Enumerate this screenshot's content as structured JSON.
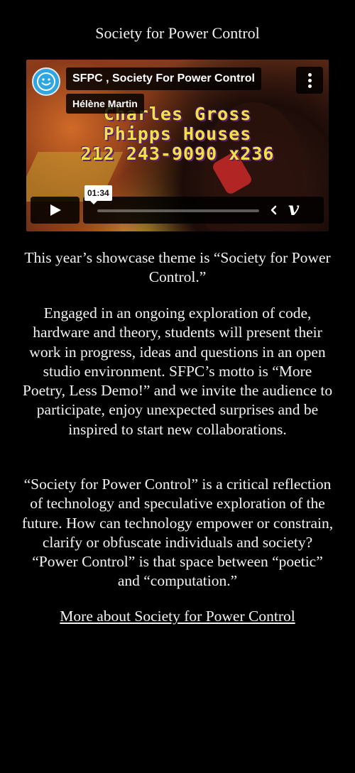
{
  "header": {
    "title": "Society for Power Control"
  },
  "video": {
    "title": "SFPC , Society For Power Control",
    "author": "Hélène Martin",
    "frame_text": [
      "Charles Gross",
      "Phipps Houses",
      "212 243-9090 x236"
    ],
    "time": "01:34",
    "progress_fraction": 0.0,
    "icons": {
      "avatar": "smiley-avatar-icon",
      "menu": "vertical-dots-icon",
      "play": "play-icon",
      "share": "chevron-left-icon",
      "brand": "vimeo-icon"
    },
    "brand_glyph": "v",
    "colors": {
      "avatar_bg": "#2ea6e0",
      "overlay_text": "#f2e04a"
    }
  },
  "content": {
    "paragraph1": "This year’s showcase theme is “Society for Power Control.”",
    "paragraph2": "Engaged in an ongoing exploration of code, hardware and theory, students will present their work in progress, ideas and questions in an open studio environment. SFPC’s motto is “More Poetry, Less Demo!” and we invite the audience to participate, enjoy unexpected surprises and be inspired to start new collaborations.",
    "paragraph3": "“Society for Power Control” is a critical reflection of technology and speculative exploration of the future. How can technology empower or constrain, clarify or obfuscate individuals and society? “Power Control” is that space between “poetic” and “computation.”",
    "more_link": "More about Society for Power Control"
  }
}
